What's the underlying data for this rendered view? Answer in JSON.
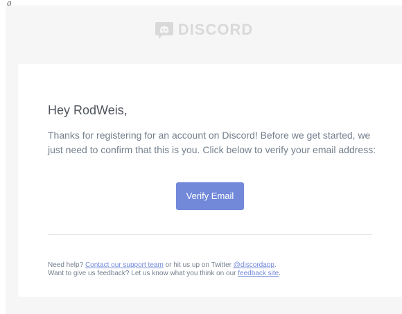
{
  "top_fragment": "g",
  "logo": {
    "icon": "discord-logo-icon",
    "text": "DISCORD",
    "color": "#d9d9d9"
  },
  "email": {
    "greeting": "Hey RodWeis,",
    "message": "Thanks for registering for an account on Discord! Before we get started, we just need to confirm that this is you. Click below to verify your email address:",
    "verify_button_label": "Verify Email",
    "accent_color": "#7289da"
  },
  "footer": {
    "line1_prefix": "Need help? ",
    "support_link": "Contact our support team",
    "line1_middle": " or hit us up on Twitter ",
    "twitter_link": "@discordapp",
    "line1_suffix": ".",
    "line2_prefix": "Want to give us feedback? Let us know what you think on our ",
    "feedback_link": "feedback site",
    "line2_suffix": "."
  }
}
